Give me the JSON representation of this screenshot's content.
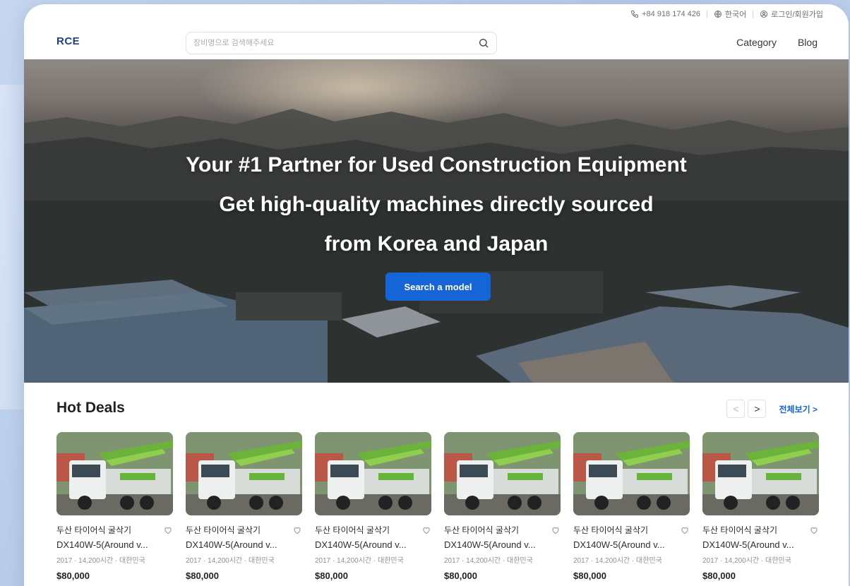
{
  "topbar": {
    "phone": "+84 918 174 426",
    "language": "한국어",
    "login": "로그인/회원가입"
  },
  "header": {
    "logo": "RCE",
    "search_placeholder": "장비명으로 검색해주세요",
    "nav": [
      "Category",
      "Blog"
    ]
  },
  "hero": {
    "line1": "Your #1 Partner for Used Construction Equipment",
    "line2": "Get high-quality machines directly sourced",
    "line3": "from Korea and Japan",
    "button": "Search a model"
  },
  "deals": {
    "title": "Hot Deals",
    "prev": "<",
    "next": ">",
    "view_all": "전체보기 >",
    "cards": [
      {
        "name": "두산 타이어식 굴삭기",
        "model": "DX140W-5(Around v...",
        "meta": "2017 · 14,200시간 · 대한민국",
        "price": "$80,000"
      },
      {
        "name": "두산 타이어식 굴삭기",
        "model": "DX140W-5(Around v...",
        "meta": "2017 · 14,200시간 · 대한민국",
        "price": "$80,000"
      },
      {
        "name": "두산 타이어식 굴삭기",
        "model": "DX140W-5(Around v...",
        "meta": "2017 · 14,200시간 · 대한민국",
        "price": "$80,000"
      },
      {
        "name": "두산 타이어식 굴삭기",
        "model": "DX140W-5(Around v...",
        "meta": "2017 · 14,200시간 · 대한민국",
        "price": "$80,000"
      },
      {
        "name": "두산 타이어식 굴삭기",
        "model": "DX140W-5(Around v...",
        "meta": "2017 · 14,200시간 · 대한민국",
        "price": "$80,000"
      },
      {
        "name": "두산 타이어식 굴삭기",
        "model": "DX140W-5(Around v...",
        "meta": "2017 · 14,200시간 · 대한민국",
        "price": "$80,000"
      }
    ]
  },
  "colors": {
    "accent": "#1565d8",
    "logo": "#1f3f86"
  },
  "icons": {
    "phone": "phone-icon",
    "globe": "globe-icon",
    "user": "user-circle-icon",
    "search": "search-icon",
    "heart": "heart-icon"
  }
}
